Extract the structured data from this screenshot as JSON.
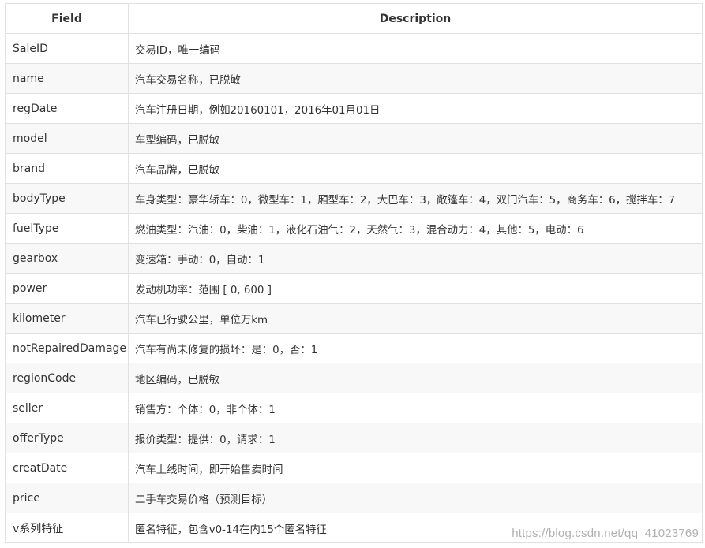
{
  "table": {
    "headers": {
      "field": "Field",
      "description": "Description"
    },
    "rows": [
      {
        "field": "SaleID",
        "description": "交易ID，唯一编码"
      },
      {
        "field": "name",
        "description": "汽车交易名称，已脱敏"
      },
      {
        "field": "regDate",
        "description": "汽车注册日期，例如20160101，2016年01月01日"
      },
      {
        "field": "model",
        "description": "车型编码，已脱敏"
      },
      {
        "field": "brand",
        "description": "汽车品牌，已脱敏"
      },
      {
        "field": "bodyType",
        "description": "车身类型：豪华轿车：0，微型车：1，厢型车：2，大巴车：3，敞篷车：4，双门汽车：5，商务车：6，搅拌车：7"
      },
      {
        "field": "fuelType",
        "description": "燃油类型：汽油：0，柴油：1，液化石油气：2，天然气：3，混合动力：4，其他：5，电动：6"
      },
      {
        "field": "gearbox",
        "description": "变速箱：手动：0，自动：1"
      },
      {
        "field": "power",
        "description": "发动机功率：范围 [ 0, 600 ]"
      },
      {
        "field": "kilometer",
        "description": "汽车已行驶公里，单位万km"
      },
      {
        "field": "notRepairedDamage",
        "description": "汽车有尚未修复的损坏：是：0，否：1"
      },
      {
        "field": "regionCode",
        "description": "地区编码，已脱敏"
      },
      {
        "field": "seller",
        "description": "销售方：个体：0，非个体：1"
      },
      {
        "field": "offerType",
        "description": "报价类型：提供：0，请求：1"
      },
      {
        "field": "creatDate",
        "description": "汽车上线时间，即开始售卖时间"
      },
      {
        "field": "price",
        "description": "二手车交易价格（预测目标）"
      },
      {
        "field": "v系列特征",
        "description": "匿名特征，包含v0-14在内15个匿名特征"
      }
    ]
  },
  "watermark": "https://blog.csdn.net/qq_41023769",
  "colors": {
    "border": "#dfe2e5",
    "stripe": "#f8f8f8",
    "text": "#333333"
  }
}
